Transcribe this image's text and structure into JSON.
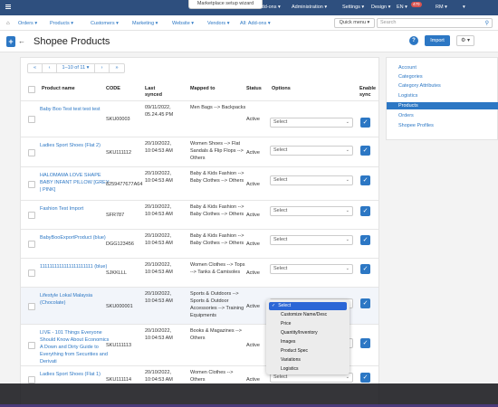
{
  "topbar": {
    "wizard": "Marketplace setup wizard",
    "addons": "Add-ons ▾",
    "administration": "Administration ▾",
    "settings": "Settings ▾",
    "design": "Design ▾",
    "language": "EN ▾",
    "notif_count": "470",
    "user": "RM ▾",
    "account": "▾"
  },
  "nav": {
    "orders": "Orders ▾",
    "products": "Products ▾",
    "customers": "Customers ▾",
    "marketing": "Marketing ▾",
    "website": "Website ▾",
    "vendors": "Vendors ▾",
    "all_addons": "All: Add-ons ▾",
    "quick_menu": "Quick menu ▾",
    "search_placeholder": "Search"
  },
  "page": {
    "title": "Shopee Products",
    "import_label": "Import",
    "help": "?",
    "add": "+",
    "back": "←",
    "gear": "⚙ ▾"
  },
  "pager": {
    "first": "«",
    "prev": "‹",
    "range": "1–10 of 11 ▾",
    "next": "›",
    "last": "»"
  },
  "table": {
    "headers": {
      "product": "Product name",
      "code": "CODE",
      "last_synced": "Last synced",
      "mapped": "Mapped to",
      "status": "Status",
      "options": "Options",
      "enable": "Enable sync"
    },
    "rows": [
      {
        "name": "Baby Boo Test test test test",
        "code": "SKU00003",
        "synced": "09/11/2022, 05.24.45 PM",
        "mapped": "Men Bags --> Backpacks",
        "status": "Active",
        "option": "Select"
      },
      {
        "name": "Ladies Sport Shoes (Flat 2)",
        "code": "SKU111112",
        "synced": "20/10/2022, 10:04:53 AM",
        "mapped": "Women Shoes --> Flat Sandals & Flip Flops --> Others",
        "status": "Active",
        "option": "Select"
      },
      {
        "name": "HALOMAMA LOVE SHAPE BABY INFANT PILLOW [GREY | PINK]",
        "code": "8259477677A64",
        "synced": "20/10/2022, 10:04:53 AM",
        "mapped": "Baby & Kids Fashion --> Baby Clothes --> Others",
        "status": "Active",
        "option": "Select"
      },
      {
        "name": "Fashion Test Import",
        "code": "SFR787",
        "synced": "20/10/2022, 10:04:53 AM",
        "mapped": "Baby & Kids Fashion --> Baby Clothes --> Others",
        "status": "Active",
        "option": "Select"
      },
      {
        "name": "BabyBooExportProduct (blue)",
        "code": "DGG123456",
        "synced": "20/10/2022, 10:04:53 AM",
        "mapped": "Baby & Kids Fashion --> Baby Clothes --> Others",
        "status": "Active",
        "option": "Select"
      },
      {
        "name": "1111111111111111111111 (blue)",
        "code": "SJKKLLL",
        "synced": "20/10/2022, 10:04:53 AM",
        "mapped": "Women Clothes --> Tops --> Tanks & Camisoles",
        "status": "Active",
        "option": "Select"
      },
      {
        "name": "Lifestyle Lokal Malaysia (Chocolate)",
        "code": "SKU000001",
        "synced": "20/10/2022, 10:04:53 AM",
        "mapped": "Sports & Outdoors --> Sports & Outdoor Accessories --> Training Equipments",
        "status": "Active",
        "option": "Select"
      },
      {
        "name": "LIVE - 101 Things Everyone Should Know About Economics A Down and Dirty Guide to Everything from Securities and Derivati",
        "code": "SKU111113",
        "synced": "20/10/2022, 10:04:53 AM",
        "mapped": "Books & Magazines --> Others",
        "status": "Active",
        "option": "Select"
      },
      {
        "name": "Ladies Sport Shoes (Flat 1)",
        "code": "SKU111114",
        "synced": "20/10/2022, 10:04:53 AM",
        "mapped": "Women Clothes --> Others",
        "status": "Active",
        "option": "Select"
      }
    ]
  },
  "dropdown": {
    "items": [
      "Select",
      "Customize Name/Desc",
      "Price",
      "Quantity/Inventory",
      "Images",
      "Product Spec",
      "Variations",
      "Logistics"
    ],
    "selected_index": 0,
    "check": "✓"
  },
  "right_panel": {
    "items": [
      "Account",
      "Categories",
      "Category Attributes",
      "Logistics",
      "Products",
      "Orders",
      "Shopee Profiles"
    ],
    "active_index": 4
  },
  "colors": {
    "topbar": "#2e4f7e",
    "accent": "#2c77c4",
    "dropdown_highlight": "#2b66d6"
  }
}
